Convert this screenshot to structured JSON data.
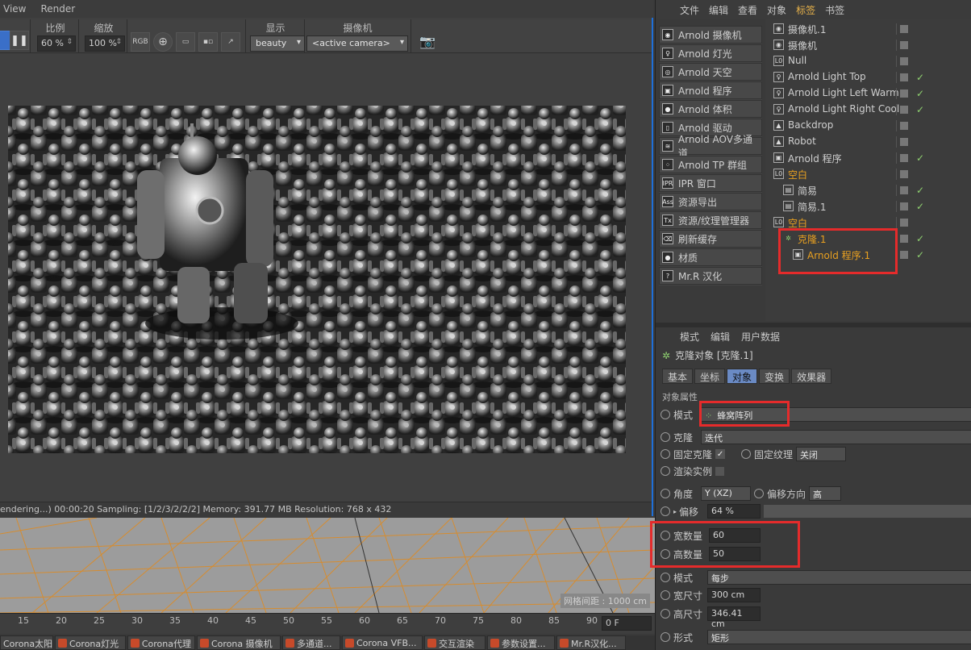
{
  "theme": {
    "accent": "#4c8af0",
    "highlight_red": "#e52b2b",
    "orange_text": "#e8a020",
    "check_green": "#8fd170"
  },
  "ipr": {
    "menu": [
      "View",
      "Render"
    ],
    "groups": {
      "scale": "比例",
      "zoom": "缩放",
      "display": "显示",
      "camera": "摄像机"
    },
    "scale_value": "60 %",
    "zoom_value": "100 %",
    "rgb_label": "RGB",
    "display_value": "beauty",
    "camera_value": "<active camera>",
    "status": "endering...)   00:00:20  Sampling: [1/2/3/2/2/2]  Memory: 391.77 MB  Resolution: 768 x 432"
  },
  "viewport": {
    "grid_label": "网格间距 : 1000 cm"
  },
  "timeline": {
    "ticks": [
      "15",
      "20",
      "25",
      "30",
      "35",
      "40",
      "45",
      "50",
      "55",
      "60",
      "65",
      "70",
      "75",
      "80",
      "85",
      "90"
    ],
    "frame": "0 F"
  },
  "taskbar": [
    "Corona太阳",
    "Corona灯光",
    "Corona代理",
    "Corona 摄像机",
    "多通道...",
    "Corona VFB...",
    "交互渲染",
    "参数设置...",
    "Mr.R汉化..."
  ],
  "object_manager": {
    "menu": [
      "文件",
      "编辑",
      "查看",
      "对象",
      "标签",
      "书签"
    ],
    "active_menu": "标签",
    "arnold_items": [
      {
        "label": "Arnold 摄像机",
        "icon": "camera-icon"
      },
      {
        "label": "Arnold 灯光",
        "icon": "bulb-icon"
      },
      {
        "label": "Arnold 天空",
        "icon": "sky-icon"
      },
      {
        "label": "Arnold 程序",
        "icon": "procedural-icon"
      },
      {
        "label": "Arnold 体积",
        "icon": "volume-icon"
      },
      {
        "label": "Arnold 驱动",
        "icon": "driver-icon"
      },
      {
        "label": "Arnold AOV多通道",
        "icon": "aov-icon"
      },
      {
        "label": "Arnold TP 群组",
        "icon": "tp-group-icon"
      },
      {
        "label": "IPR 窗口",
        "icon": "ipr-icon"
      },
      {
        "label": "资源导出",
        "icon": "ass-icon"
      },
      {
        "label": "资源/纹理管理器",
        "icon": "tx-icon"
      },
      {
        "label": "刷新缓存",
        "icon": "trash-icon"
      },
      {
        "label": "材质",
        "icon": "material-icon"
      },
      {
        "label": "Mr.R 汉化",
        "icon": "help-icon"
      }
    ],
    "objects": [
      {
        "name": "摄像机.1",
        "indent": 0,
        "icon": "camera-icon",
        "check": false,
        "color": "normal"
      },
      {
        "name": "摄像机",
        "indent": 0,
        "icon": "camera-icon",
        "check": false,
        "color": "normal"
      },
      {
        "name": "Null",
        "indent": 0,
        "icon": "null-icon",
        "check": false,
        "color": "normal"
      },
      {
        "name": "Arnold Light Top",
        "indent": 0,
        "icon": "bulb-icon",
        "check": true,
        "color": "normal"
      },
      {
        "name": "Arnold Light Left Warm",
        "indent": 0,
        "icon": "bulb-icon",
        "check": true,
        "color": "normal"
      },
      {
        "name": "Arnold Light Right Cool",
        "indent": 0,
        "icon": "bulb-icon",
        "check": true,
        "color": "normal"
      },
      {
        "name": "Backdrop",
        "indent": 0,
        "icon": "backdrop-icon",
        "check": false,
        "color": "normal"
      },
      {
        "name": "Robot",
        "indent": 0,
        "icon": "backdrop-icon",
        "check": false,
        "color": "normal"
      },
      {
        "name": "Arnold 程序",
        "indent": 0,
        "icon": "procedural-icon",
        "check": true,
        "color": "normal"
      },
      {
        "name": "空白",
        "indent": 0,
        "icon": "null-icon",
        "check": false,
        "color": "orange"
      },
      {
        "name": "简易",
        "indent": 1,
        "icon": "simple-icon",
        "check": true,
        "color": "normal"
      },
      {
        "name": "简易.1",
        "indent": 1,
        "icon": "simple-icon",
        "check": true,
        "color": "normal"
      },
      {
        "name": "空白",
        "indent": 0,
        "icon": "null-icon",
        "check": false,
        "color": "orange"
      },
      {
        "name": "克隆.1",
        "indent": 1,
        "icon": "cloner-icon",
        "check": true,
        "color": "orange"
      },
      {
        "name": "Arnold 程序.1",
        "indent": 2,
        "icon": "procedural-icon",
        "check": true,
        "color": "orange"
      }
    ]
  },
  "attributes": {
    "menu": [
      "模式",
      "编辑",
      "用户数据"
    ],
    "title": "克隆对象 [克隆.1]",
    "tabs": [
      "基本",
      "坐标",
      "对象",
      "变换",
      "效果器"
    ],
    "active_tab": "对象",
    "section": "对象属性",
    "mode_label": "模式",
    "mode_value": "蜂窝阵列",
    "clone_label": "克隆",
    "clone_value": "迭代",
    "fixed_clone_label": "固定克隆",
    "fixed_texture_label": "固定纹理",
    "fixed_texture_value": "关闭",
    "render_instance_label": "渲染实例",
    "angle_label": "角度",
    "angle_value": "Y (XZ)",
    "offset_dir_label": "偏移方向",
    "offset_dir_value": "高",
    "offset_label": "偏移",
    "offset_value": "64 %",
    "width_count_label": "宽数量",
    "width_count_value": "60",
    "height_count_label": "高数量",
    "height_count_value": "50",
    "form_label": "模式",
    "form_value": "每步",
    "width_size_label": "宽尺寸",
    "width_size_value": "300 cm",
    "height_size_label": "高尺寸",
    "height_size_value": "346.41 cm",
    "shape_label": "形式",
    "shape_value": "矩形"
  }
}
